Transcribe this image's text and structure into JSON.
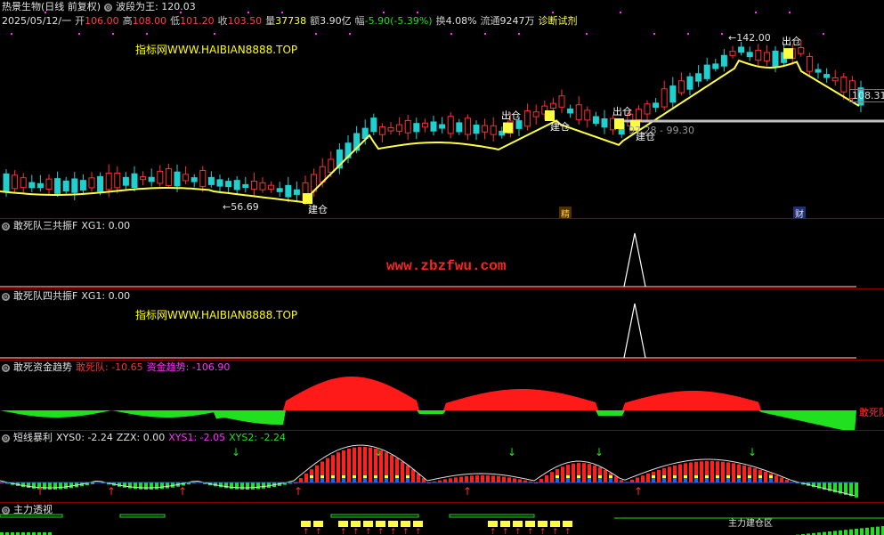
{
  "header": {
    "stock_name": "热景生物(日线 前复权)",
    "indicator_name": "波段为王",
    "indicator_value": ": 120.03",
    "date": "2025/05/12/一",
    "open_label": "开",
    "open": "106.00",
    "high_label": "高",
    "high": "108.00",
    "low_label": "低",
    "low": "101.20",
    "close_label": "收",
    "close": "103.50",
    "vol_label": "量",
    "vol": "37738",
    "amount_label": "额",
    "amount": "3.90亿",
    "change_label": "幅",
    "change": "-5.90(-5.39%)",
    "turnover_label": "换",
    "turnover": "4.08%",
    "float_label": "流通",
    "float": "9247万",
    "diagnose": "诊断试剂"
  },
  "main": {
    "ad_text": "指标网WWW.HAIBIAN8888.TOP",
    "high_mark": "142.00",
    "low_mark": "56.69",
    "right_price": "108.31",
    "range_text": "97.28 - 99.30",
    "signals": {
      "buy": "建仓",
      "sell": "出仓"
    },
    "badges": [
      "精",
      "财"
    ]
  },
  "panels": [
    {
      "title": "敢死队三共振F",
      "params": "XG1: 0.00",
      "watermark": "www.zbzfwu.com"
    },
    {
      "title": "敢死队四共振F",
      "params": "XG1: 0.00",
      "ad_text": "指标网WWW.HAIBIAN8888.TOP"
    },
    {
      "title": "敢死资金趋势",
      "p1": "敢死队: -10.65",
      "p2": "资金趋势: -106.90",
      "right_label": "敢死队"
    },
    {
      "title": "短线暴利",
      "p1": "XYS0: -2.24",
      "p2": "ZZX: 0.00",
      "p3": "XYS1: -2.05",
      "p4": "XYS2: -2.24"
    },
    {
      "title": "主力透视",
      "right_label": "主力建仓区"
    }
  ],
  "colors": {
    "up": "#ff3030",
    "down": "#20d0d0",
    "ma": "#ffff40",
    "divider": "#8a0000",
    "green": "#20e020",
    "magenta": "#ff30ff"
  }
}
